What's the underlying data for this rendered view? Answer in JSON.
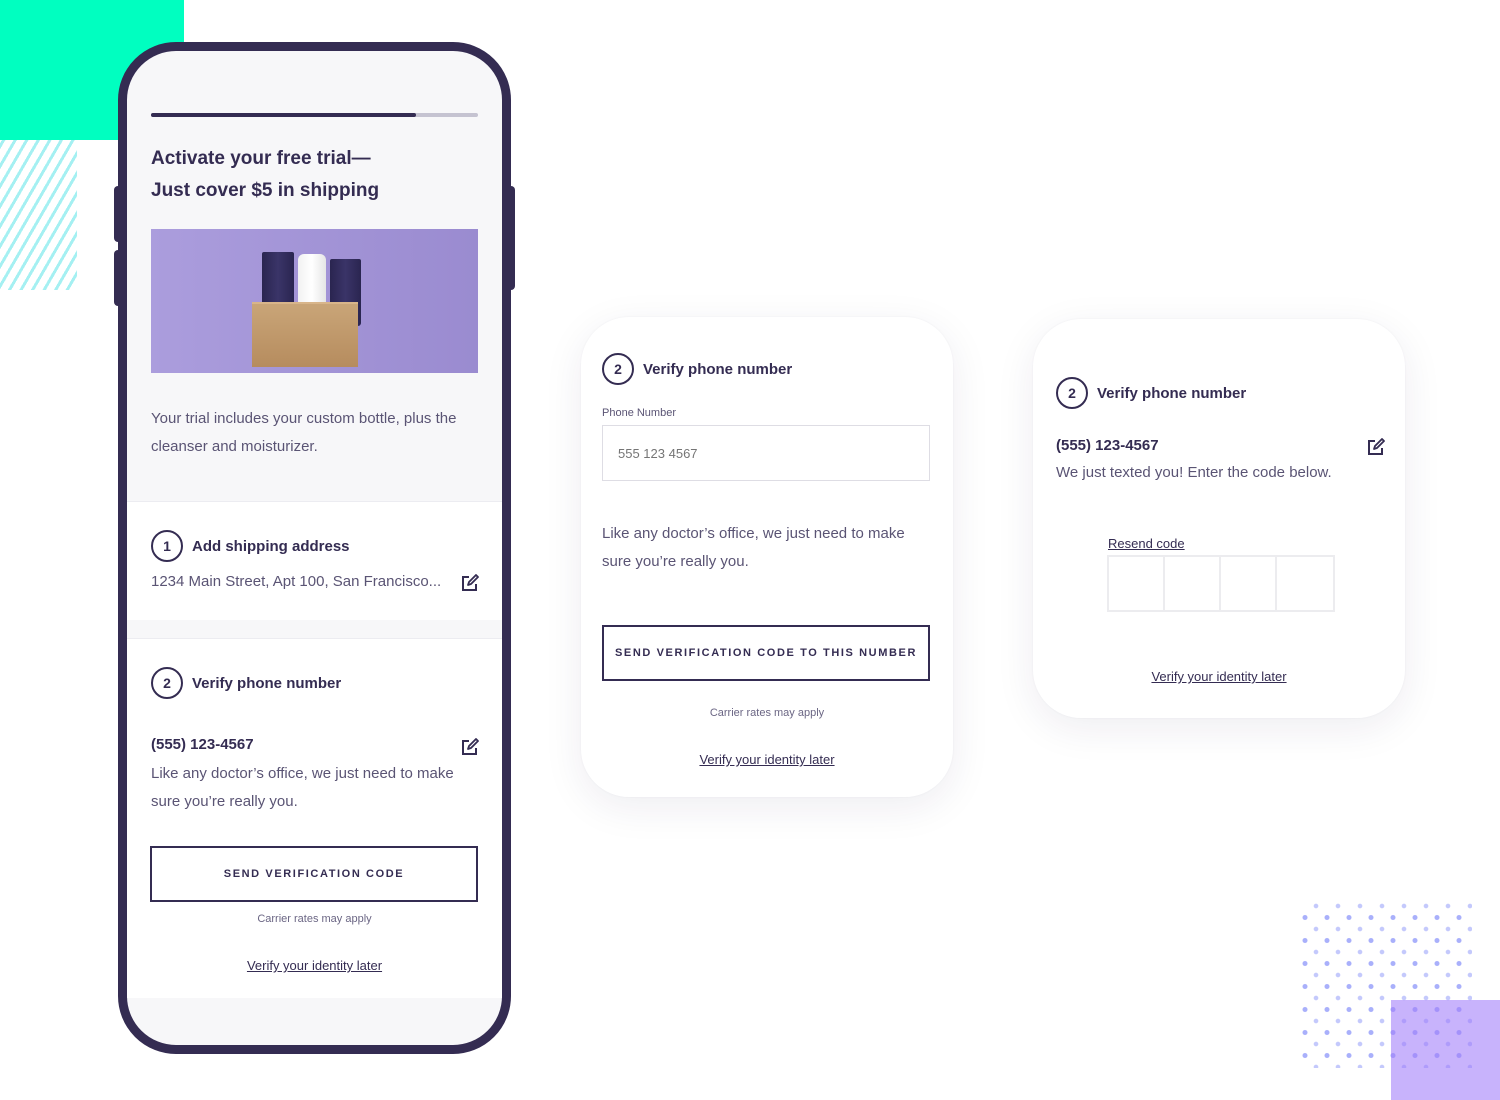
{
  "colors": {
    "brand": "#342c52",
    "accent_green": "#00ffc0",
    "accent_purple": "#a07cfa"
  },
  "phone": {
    "progress_percent": 81,
    "hero": {
      "title_line1": "Activate your free trial—",
      "title_line2": "Just cover $5 in shipping",
      "image_alt": "Curology product bottles on shipping box",
      "description": "Your trial includes your custom bottle, plus the cleanser and moisturizer."
    },
    "step1": {
      "number": "1",
      "title": "Add shipping address",
      "address": "1234 Main Street, Apt 100, San Francisco...",
      "edit_icon": "edit-icon"
    },
    "step2": {
      "number": "2",
      "title": "Verify phone number",
      "phone": "(555) 123-4567",
      "edit_icon": "edit-icon",
      "description_line1": "Like any doctor’s office, we just need to make",
      "description_line2": "sure you’re really you.",
      "button": "SEND VERIFICATION CODE",
      "note": "Carrier rates may apply",
      "later_link": "Verify your identity later"
    }
  },
  "card_phone_entry": {
    "number": "2",
    "title": "Verify phone number",
    "field_label": "Phone Number",
    "field_placeholder": "555 123 4567",
    "field_value": "",
    "description_line1": "Like any doctor’s office, we just need to make",
    "description_line2": "sure you’re really you.",
    "button": "SEND VERIFICATION CODE TO THIS NUMBER",
    "note": "Carrier rates may apply",
    "later_link": "Verify your identity later"
  },
  "card_code_entry": {
    "number": "2",
    "title": "Verify phone number",
    "phone": "(555) 123-4567",
    "edit_icon": "edit-icon",
    "instruction": "We just texted you! Enter the code below.",
    "resend_link": "Resend code",
    "code_digits": [
      "",
      "",
      "",
      ""
    ],
    "later_link": "Verify your identity later"
  }
}
